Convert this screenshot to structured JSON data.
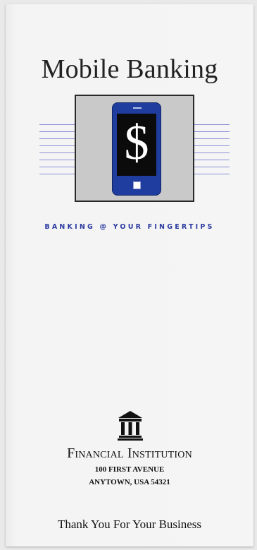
{
  "brochure": {
    "title": "Mobile Banking",
    "tagline": "BANKING @ YOUR FINGERTIPS",
    "screen_symbol": "$",
    "institution": {
      "name": "Financial Institution",
      "address_line1": "100 FIRST AVENUE",
      "address_line2": "ANYTOWN, USA 54321"
    },
    "closing": "Thank You For Your Business"
  },
  "icons": {
    "phone": "smartphone-icon",
    "building": "bank-building-icon"
  },
  "colors": {
    "phone_body": "#1e3d9e",
    "tagline": "#2b3aa0",
    "accent_lines": "#8a8fd6",
    "frame_fill": "#c9c9c9"
  }
}
